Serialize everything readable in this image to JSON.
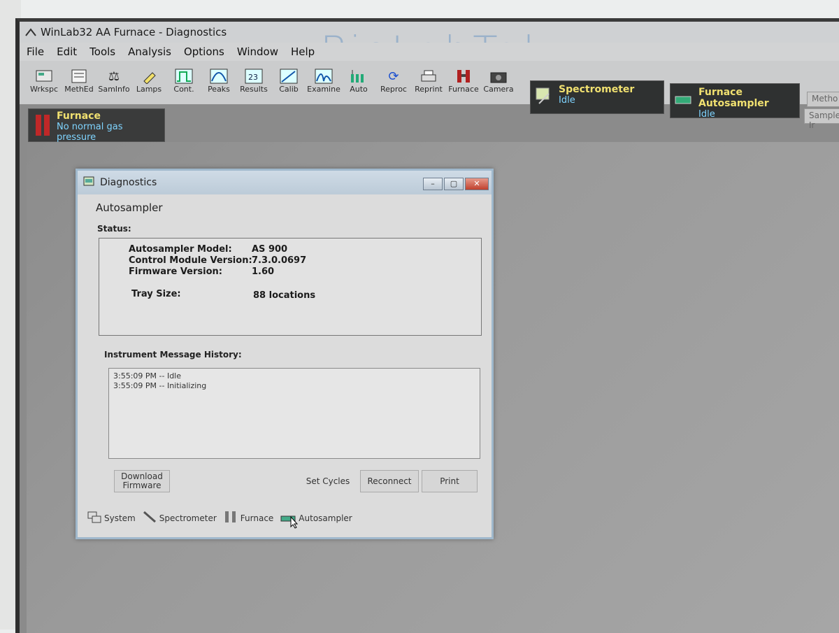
{
  "window": {
    "title": "WinLab32 AA Furnace - Diagnostics"
  },
  "watermark": "BioLabTek",
  "menu": [
    "File",
    "Edit",
    "Tools",
    "Analysis",
    "Options",
    "Window",
    "Help"
  ],
  "toolbar": [
    {
      "label": "Wrkspc",
      "icon": "workspace-icon"
    },
    {
      "label": "MethEd",
      "icon": "method-editor-icon"
    },
    {
      "label": "SamInfo",
      "icon": "balance-icon"
    },
    {
      "label": "Lamps",
      "icon": "lamp-icon"
    },
    {
      "label": "Cont.",
      "icon": "continuous-graph-icon"
    },
    {
      "label": "Peaks",
      "icon": "peaks-icon"
    },
    {
      "label": "Results",
      "icon": "results-icon"
    },
    {
      "label": "Calib",
      "icon": "calibration-icon"
    },
    {
      "label": "Examine",
      "icon": "examine-icon"
    },
    {
      "label": "Auto",
      "icon": "autosampler-icon"
    },
    {
      "label": "Reproc",
      "icon": "reprocess-icon"
    },
    {
      "label": "Reprint",
      "icon": "printer-icon"
    },
    {
      "label": "Furnace",
      "icon": "furnace-icon"
    },
    {
      "label": "Camera",
      "icon": "camera-icon"
    }
  ],
  "status_panels": {
    "spectrometer": {
      "title": "Spectrometer",
      "status": "Idle"
    },
    "furnace_autosampler": {
      "title": "Furnace Autosampler",
      "status": "Idle"
    },
    "furnace": {
      "title": "Furnace",
      "status": "No normal gas pressure"
    }
  },
  "right_tabs": [
    "Metho",
    "Sample Ir"
  ],
  "dialog": {
    "title": "Diagnostics",
    "section": "Autosampler",
    "status_label": "Status:",
    "fields": [
      {
        "label": "Autosampler Model:",
        "value": "AS 900"
      },
      {
        "label": "Control Module Version:",
        "value": "7.3.0.0697"
      },
      {
        "label": "Firmware Version:",
        "value": "1.60"
      },
      {
        "label": "Tray Size:",
        "value": "88 locations"
      }
    ],
    "history_label": "Instrument Message History:",
    "history": [
      "3:55:09 PM -- Idle",
      "3:55:09 PM -- Initializing"
    ],
    "buttons": {
      "download_firmware": "Download Firmware",
      "set_cycles": "Set Cycles",
      "reconnect": "Reconnect",
      "print": "Print"
    },
    "tabs": [
      "System",
      "Spectrometer",
      "Furnace",
      "Autosampler"
    ]
  }
}
